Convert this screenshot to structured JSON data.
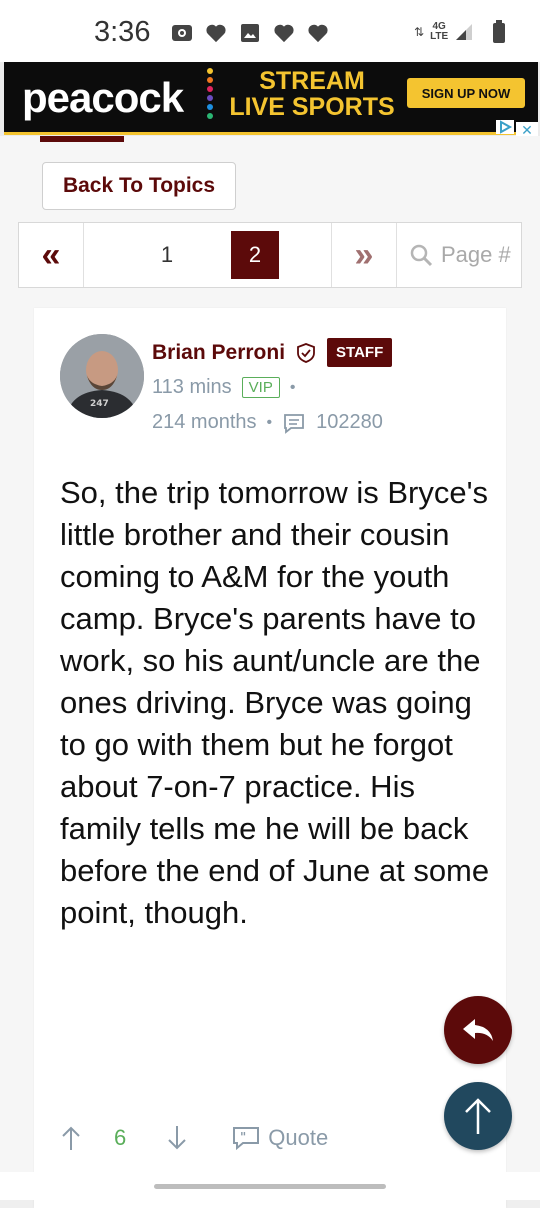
{
  "status_bar": {
    "time": "3:36",
    "network": "4G",
    "network_sub": "LTE",
    "icons": [
      "radio-icon",
      "heart-icon",
      "image-icon",
      "heart-icon",
      "heart-icon"
    ]
  },
  "ad": {
    "brand": "peacock",
    "headline_line1": "STREAM",
    "headline_line2": "LIVE SPORTS",
    "cta": "SIGN UP NOW",
    "colors": {
      "accent": "#f4c430",
      "background": "#0c0c0c"
    }
  },
  "nav": {
    "back_label": "Back To Topics"
  },
  "pagination": {
    "prev": "«",
    "pages": [
      "1",
      "2"
    ],
    "current": "2",
    "next": "»",
    "search_placeholder": "Page #"
  },
  "post": {
    "author": "Brian Perroni",
    "badge": "STAFF",
    "time_ago": "113 mins",
    "membership": "VIP",
    "tenure": "214 months",
    "post_count": "102280",
    "body": "So, the trip tomorrow is Bryce's little brother and their cousin coming to A&M for the youth camp. Bryce's parents have to work, so his aunt/uncle are the ones driving. Bryce was going to go with them but he forgot about 7-on-7 practice. His family tells me he will be back before the end of June at some point, though.",
    "votes": "6",
    "quote_label": "Quote"
  },
  "theme": {
    "primary": "#5c0a0a",
    "muted": "#8a9aa8",
    "positive": "#5aae5a",
    "scroll_top": "#21485e"
  }
}
